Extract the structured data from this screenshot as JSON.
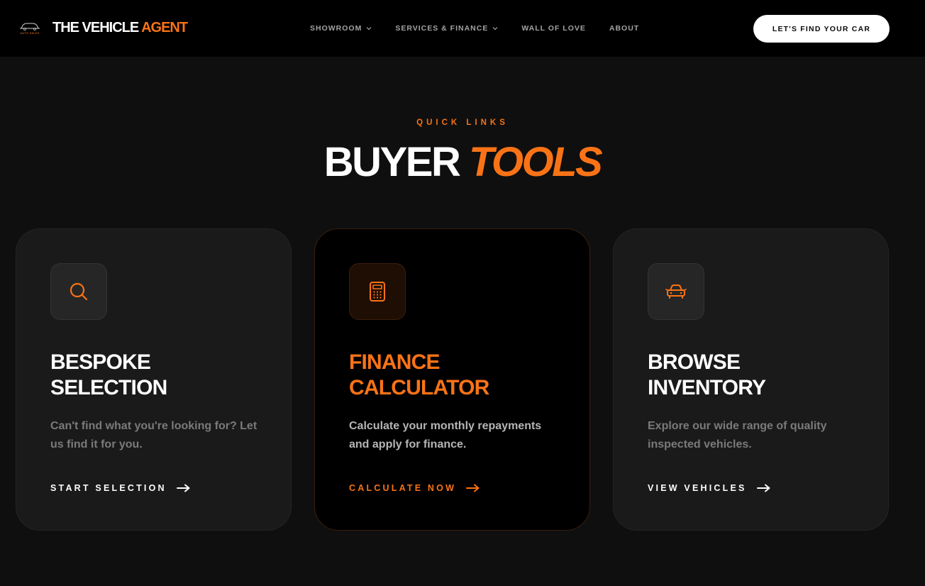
{
  "brand": {
    "logo_icon": "car-outline-icon",
    "logo_text": "AUTO SALES",
    "name_main": "THE VEHICLE ",
    "name_accent": "AGENT"
  },
  "nav": {
    "items": [
      {
        "label": "SHOWROOM",
        "has_dropdown": true
      },
      {
        "label": "SERVICES & FINANCE",
        "has_dropdown": true
      },
      {
        "label": "WALL OF LOVE",
        "has_dropdown": false
      },
      {
        "label": "ABOUT",
        "has_dropdown": false
      }
    ],
    "cta_label": "LET'S FIND YOUR CAR"
  },
  "section": {
    "eyebrow": "QUICK LINKS",
    "title_main": "BUYER ",
    "title_accent": "TOOLS"
  },
  "cards": [
    {
      "icon": "search-icon",
      "title_line1": "BESPOKE",
      "title_line2": "SELECTION",
      "description": "Can't find what you're looking for? Let us find it for you.",
      "link_label": "START SELECTION",
      "featured": false
    },
    {
      "icon": "calculator-icon",
      "title_line1": "FINANCE",
      "title_line2": "CALCULATOR",
      "description": "Calculate your monthly repayments and apply for finance.",
      "link_label": "CALCULATE NOW",
      "featured": true
    },
    {
      "icon": "car-icon",
      "title_line1": "BROWSE",
      "title_line2": "INVENTORY",
      "description": "Explore our wide range of quality inspected vehicles.",
      "link_label": "VIEW VEHICLES",
      "featured": false
    }
  ],
  "colors": {
    "accent": "#f97316",
    "background": "#0f0f0f",
    "header_bg": "#000000",
    "card_bg": "#1a1a1a",
    "featured_card_bg": "#000000"
  }
}
